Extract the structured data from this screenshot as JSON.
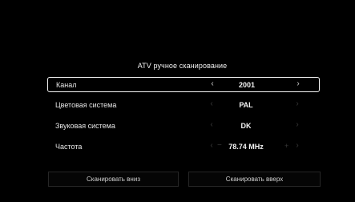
{
  "dialog": {
    "title": "ATV ручное сканирование",
    "rows": [
      {
        "label": "Канал",
        "value": "2001"
      },
      {
        "label": "Цветовая система",
        "value": "PAL"
      },
      {
        "label": "Звуковая система",
        "value": "DK"
      },
      {
        "label": "Частота",
        "value": "78.74 MHz"
      }
    ],
    "selected_row": "Канал",
    "arrows": {
      "left": "‹",
      "right": "›",
      "minus": "−",
      "plus": "+"
    },
    "buttons": {
      "scan_down": "Сканировать вниз",
      "scan_up": "Сканировать вверх"
    }
  },
  "colors": {
    "background": "#000000",
    "text": "#ffffff",
    "selection_border": "#f4f4f4",
    "disabled_arrow": "#3a3a3a"
  }
}
